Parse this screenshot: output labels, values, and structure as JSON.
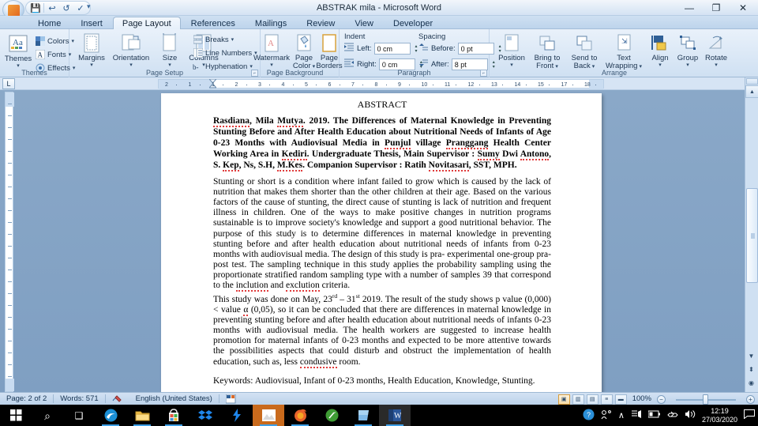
{
  "window": {
    "title": "ABSTRAK mila - Microsoft Word",
    "minimize": "—",
    "maximize": "❐",
    "close": "✕"
  },
  "quick_access": {
    "save": "💾",
    "undo": "↩",
    "redo": "↺",
    "spelling": "✓",
    "customize": "▾"
  },
  "tabs": [
    {
      "label": "Home",
      "active": false
    },
    {
      "label": "Insert",
      "active": false
    },
    {
      "label": "Page Layout",
      "active": true
    },
    {
      "label": "References",
      "active": false
    },
    {
      "label": "Mailings",
      "active": false
    },
    {
      "label": "Review",
      "active": false
    },
    {
      "label": "View",
      "active": false
    },
    {
      "label": "Developer",
      "active": false
    }
  ],
  "ribbon": {
    "themes": {
      "group_label": "Themes",
      "themes_button": "Themes",
      "colors": "Colors",
      "fonts": "Fonts",
      "effects": "Effects"
    },
    "page_setup": {
      "group_label": "Page Setup",
      "margins": "Margins",
      "orientation": "Orientation",
      "size": "Size",
      "columns": "Columns",
      "breaks": "Breaks",
      "line_numbers": "Line Numbers",
      "hyphenation": "Hyphenation"
    },
    "page_background": {
      "group_label": "Page Background",
      "watermark": "Watermark",
      "page_color_1": "Page",
      "page_color_2": "Color",
      "page_borders_1": "Page",
      "page_borders_2": "Borders"
    },
    "paragraph": {
      "group_label": "Paragraph",
      "indent_label": "Indent",
      "spacing_label": "Spacing",
      "left_label": "Left:",
      "left_value": "0 cm",
      "right_label": "Right:",
      "right_value": "0 cm",
      "before_label": "Before:",
      "before_value": "0 pt",
      "after_label": "After:",
      "after_value": "8 pt"
    },
    "arrange": {
      "group_label": "Arrange",
      "position": "Position",
      "bring_to_front_1": "Bring to",
      "bring_to_front_2": "Front",
      "send_to_back_1": "Send to",
      "send_to_back_2": "Back",
      "text_wrapping_1": "Text",
      "text_wrapping_2": "Wrapping",
      "align": "Align",
      "group": "Group",
      "rotate": "Rotate"
    }
  },
  "ruler": {
    "horizontal_ticks": [
      "2",
      "1",
      "1",
      "2",
      "3",
      "4",
      "5",
      "6",
      "7",
      "8",
      "9",
      "10",
      "11",
      "12",
      "13",
      "14",
      "15",
      "17",
      "18"
    ]
  },
  "document": {
    "title": "ABSTRACT",
    "heading_paragraph": "Rasdiana, Mila Mutya. 2019. The Differences of Maternal Knowledge in Preventing Stunting Before and After Health Education about Nutritional Needs of Infants of Age 0-23 Months with Audiovisual Media in Punjul village Pranggang Health Center Working Area in Kediri. Undergraduate Thesis, Main Supervisor : Sumy Dwi Antono, S. Kep, Ns, S.H, M.Kes. Companion Supervisor : Ratih Novitasari, SST, MPH.",
    "paragraph_1": "Stunting or short is a condition where infant failed to grow which is caused by the lack of nutrition that makes them shorter than the other children at their age. Based on the various factors of the cause of stunting, the direct cause of stunting is lack of nutrition and frequent illness in children. One of the ways to make positive changes in nutrition programs sustainable is to improve society's knowledge and support a good nutritional behavior. The purpose of this study is to determine differences in maternal knowledge in preventing stunting before and after health education about nutritional needs of infants from 0-23 months with audiovisual media. The design of this study is pra- experimental one-group pra- post test. The sampling technique in this study applies the probability sampling using the proportionate stratified random sampling type with a number of samples 39 that correspond to the inclution and exclution criteria.",
    "paragraph_2_pre": "This study was done on May, 23",
    "paragraph_2_sup1": "rd",
    "paragraph_2_mid": " – 31",
    "paragraph_2_sup2": "st",
    "paragraph_2_post": " 2019. The result of the study shows  p value (0,000) < value α (0,05), so it can be concluded that there are differences in maternal knowledge in preventing stunting before and after health education about nutritional needs of infants 0-23 months with audiovisual media. The health workers are suggested to increase health promotion for maternal infants of 0-23 months and expected to be more attentive towards the possibilities aspects that could disturb and obstruct the implementation of health education, such as, less condusive room.",
    "keywords": "Keywords: Audiovisual, Infant of 0-23 months, Health Education, Knowledge, Stunting."
  },
  "status_bar": {
    "page": "Page: 2 of 2",
    "words": "Words: 571",
    "proofing_icon": "proofing-errors-icon",
    "language": "English (United States)",
    "macro_icon": "macro-record-icon",
    "zoom": "100%",
    "zoom_out": "−",
    "zoom_in": "+",
    "views": [
      "print-layout",
      "full-screen-reading",
      "web-layout",
      "outline",
      "draft"
    ]
  },
  "taskbar": {
    "start": "windows-start-icon",
    "items": [
      {
        "name": "search-icon",
        "glyph": "⌕"
      },
      {
        "name": "task-view-icon",
        "glyph": "❑"
      },
      {
        "name": "edge-icon",
        "glyph": "e"
      },
      {
        "name": "file-explorer-icon",
        "glyph": "🗀"
      },
      {
        "name": "microsoft-store-icon",
        "glyph": "🛍"
      },
      {
        "name": "dropbox-icon",
        "glyph": "❖"
      },
      {
        "name": "flash-icon",
        "glyph": "⚡"
      },
      {
        "name": "photos-icon",
        "glyph": "🖼"
      },
      {
        "name": "firefox-icon",
        "glyph": "🦊"
      },
      {
        "name": "onenote-icon",
        "glyph": "✎"
      },
      {
        "name": "sticky-notes-icon",
        "glyph": "📘"
      },
      {
        "name": "word-icon",
        "glyph": "W"
      }
    ],
    "tray": {
      "help_icon": "help-circle-icon",
      "people_icon": "people-icon",
      "show_hidden": "∧",
      "network_icon": "network-icon",
      "battery_icon": "battery-icon",
      "onedrive_icon": "onedrive-icon",
      "volume_icon": "volume-icon",
      "time": "12:19",
      "date": "27/03/2020",
      "action_center": "notification-icon"
    }
  }
}
